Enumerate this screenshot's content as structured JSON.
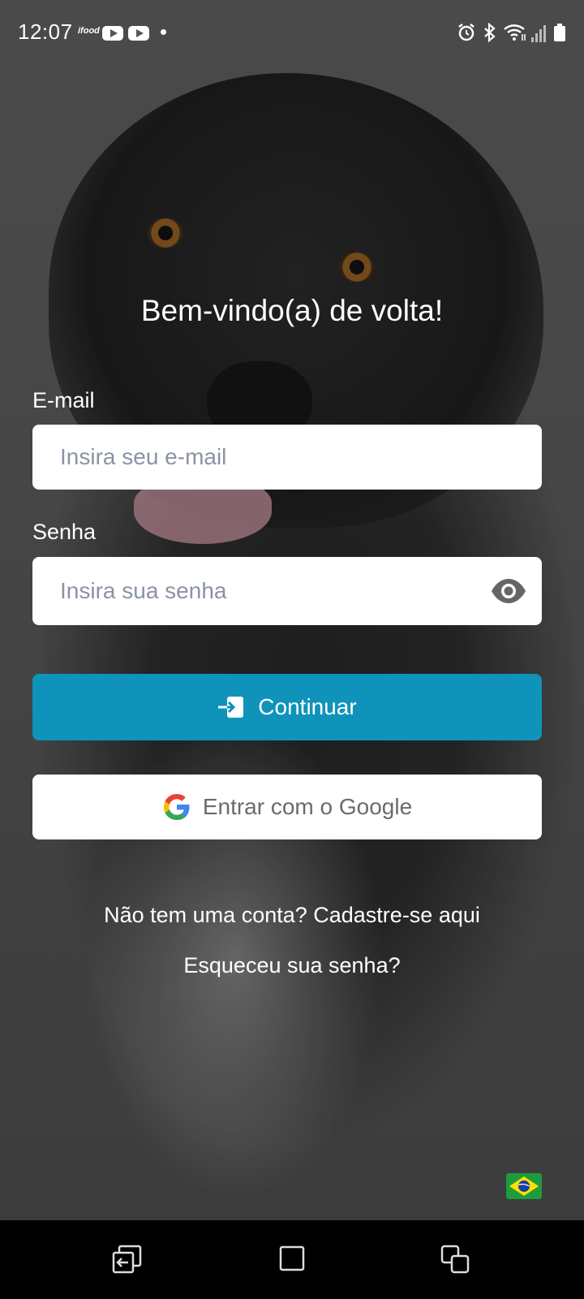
{
  "status_bar": {
    "time": "12:07",
    "app_icon_label": "ifood",
    "icons": [
      "ifood-icon",
      "youtube-icon",
      "youtube-icon",
      "notification-dot",
      "alarm-icon",
      "bluetooth-icon",
      "wifi-icon",
      "signal-icon",
      "battery-icon"
    ]
  },
  "login": {
    "title": "Bem-vindo(a) de volta!",
    "email_label": "E-mail",
    "email_placeholder": "Insira seu e-mail",
    "password_label": "Senha",
    "password_placeholder": "Insira sua senha",
    "continue_label": "Continuar",
    "google_label": "Entrar com o Google",
    "signup_text": "Não tem uma conta? Cadastre-se aqui",
    "forgot_text": "Esqueceu sua senha?"
  },
  "language": {
    "flag": "brazil-flag-icon"
  },
  "navigation": {
    "buttons": [
      "back-icon",
      "home-icon",
      "recents-icon"
    ]
  },
  "colors": {
    "primary": "#0f93bb",
    "input_bg": "#ffffff",
    "placeholder": "#8a93a3",
    "navbar": "#000000"
  }
}
